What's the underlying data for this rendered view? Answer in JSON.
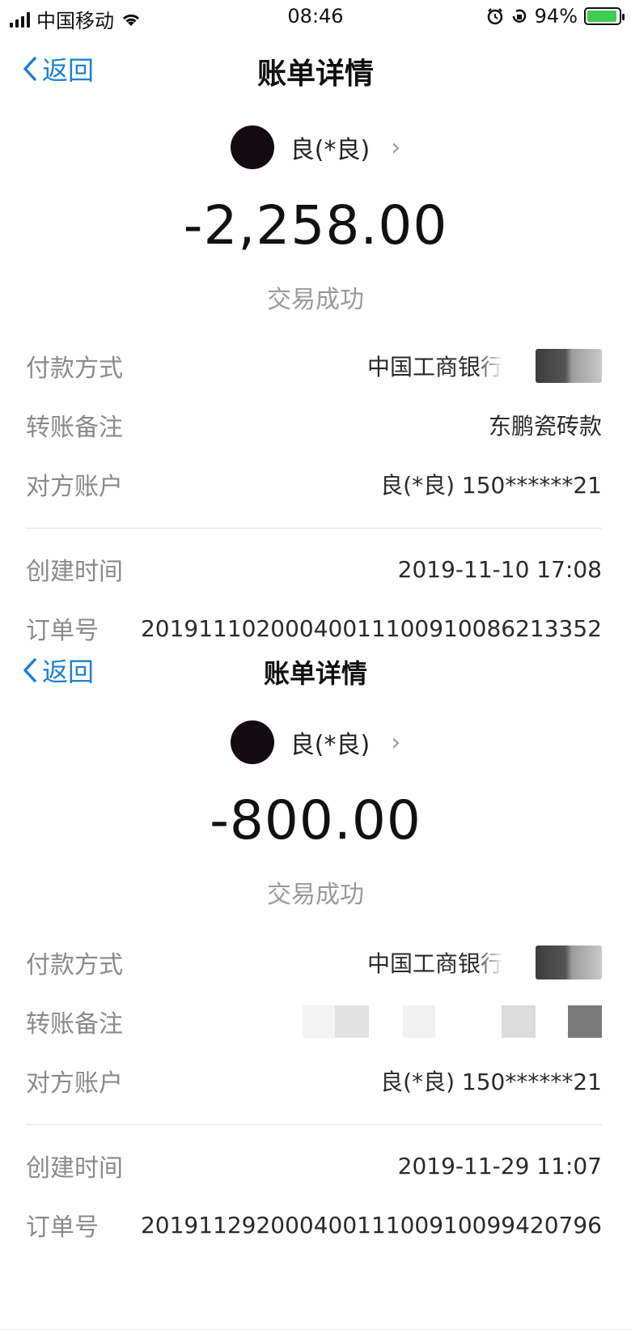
{
  "status_bar": {
    "carrier": "中国移动",
    "time": "08:46",
    "battery": "94%"
  },
  "bills": [
    {
      "nav": {
        "back_label": "返回",
        "title": "账单详情"
      },
      "payee": "良(*良)",
      "amount": "-2,258.00",
      "status": "交易成功",
      "details": {
        "payment_method_label": "付款方式",
        "payment_method_value": "中国工商银行",
        "remark_label": "转账备注",
        "remark_value": "东鹏瓷砖款",
        "counterparty_label": "对方账户",
        "counterparty_value": "良(*良) 150******21",
        "created_label": "创建时间",
        "created_value": "2019-11-10 17:08",
        "order_label": "订单号",
        "order_value": "20191110200040011100910086213352"
      }
    },
    {
      "nav": {
        "back_label": "返回",
        "title": "账单详情"
      },
      "payee": "良(*良)",
      "amount": "-800.00",
      "status": "交易成功",
      "details": {
        "payment_method_label": "付款方式",
        "payment_method_value": "中国工商银行",
        "remark_label": "转账备注",
        "counterparty_label": "对方账户",
        "counterparty_value": "良(*良) 150******21",
        "created_label": "创建时间",
        "created_value": "2019-11-29 11:07",
        "order_label": "订单号",
        "order_value": "20191129200040011100910099420796"
      }
    }
  ],
  "icons": {
    "back": "chevron-left-icon",
    "payee_arrow": "chevron-right-icon",
    "wifi": "wifi-icon",
    "alarm": "alarm-icon",
    "rotation_lock": "rotation-lock-icon",
    "battery": "battery-charging-icon"
  },
  "colors": {
    "link_blue": "#1e7fd5",
    "label_gray": "#8a8a8a",
    "battery_green": "#3ecc52"
  }
}
